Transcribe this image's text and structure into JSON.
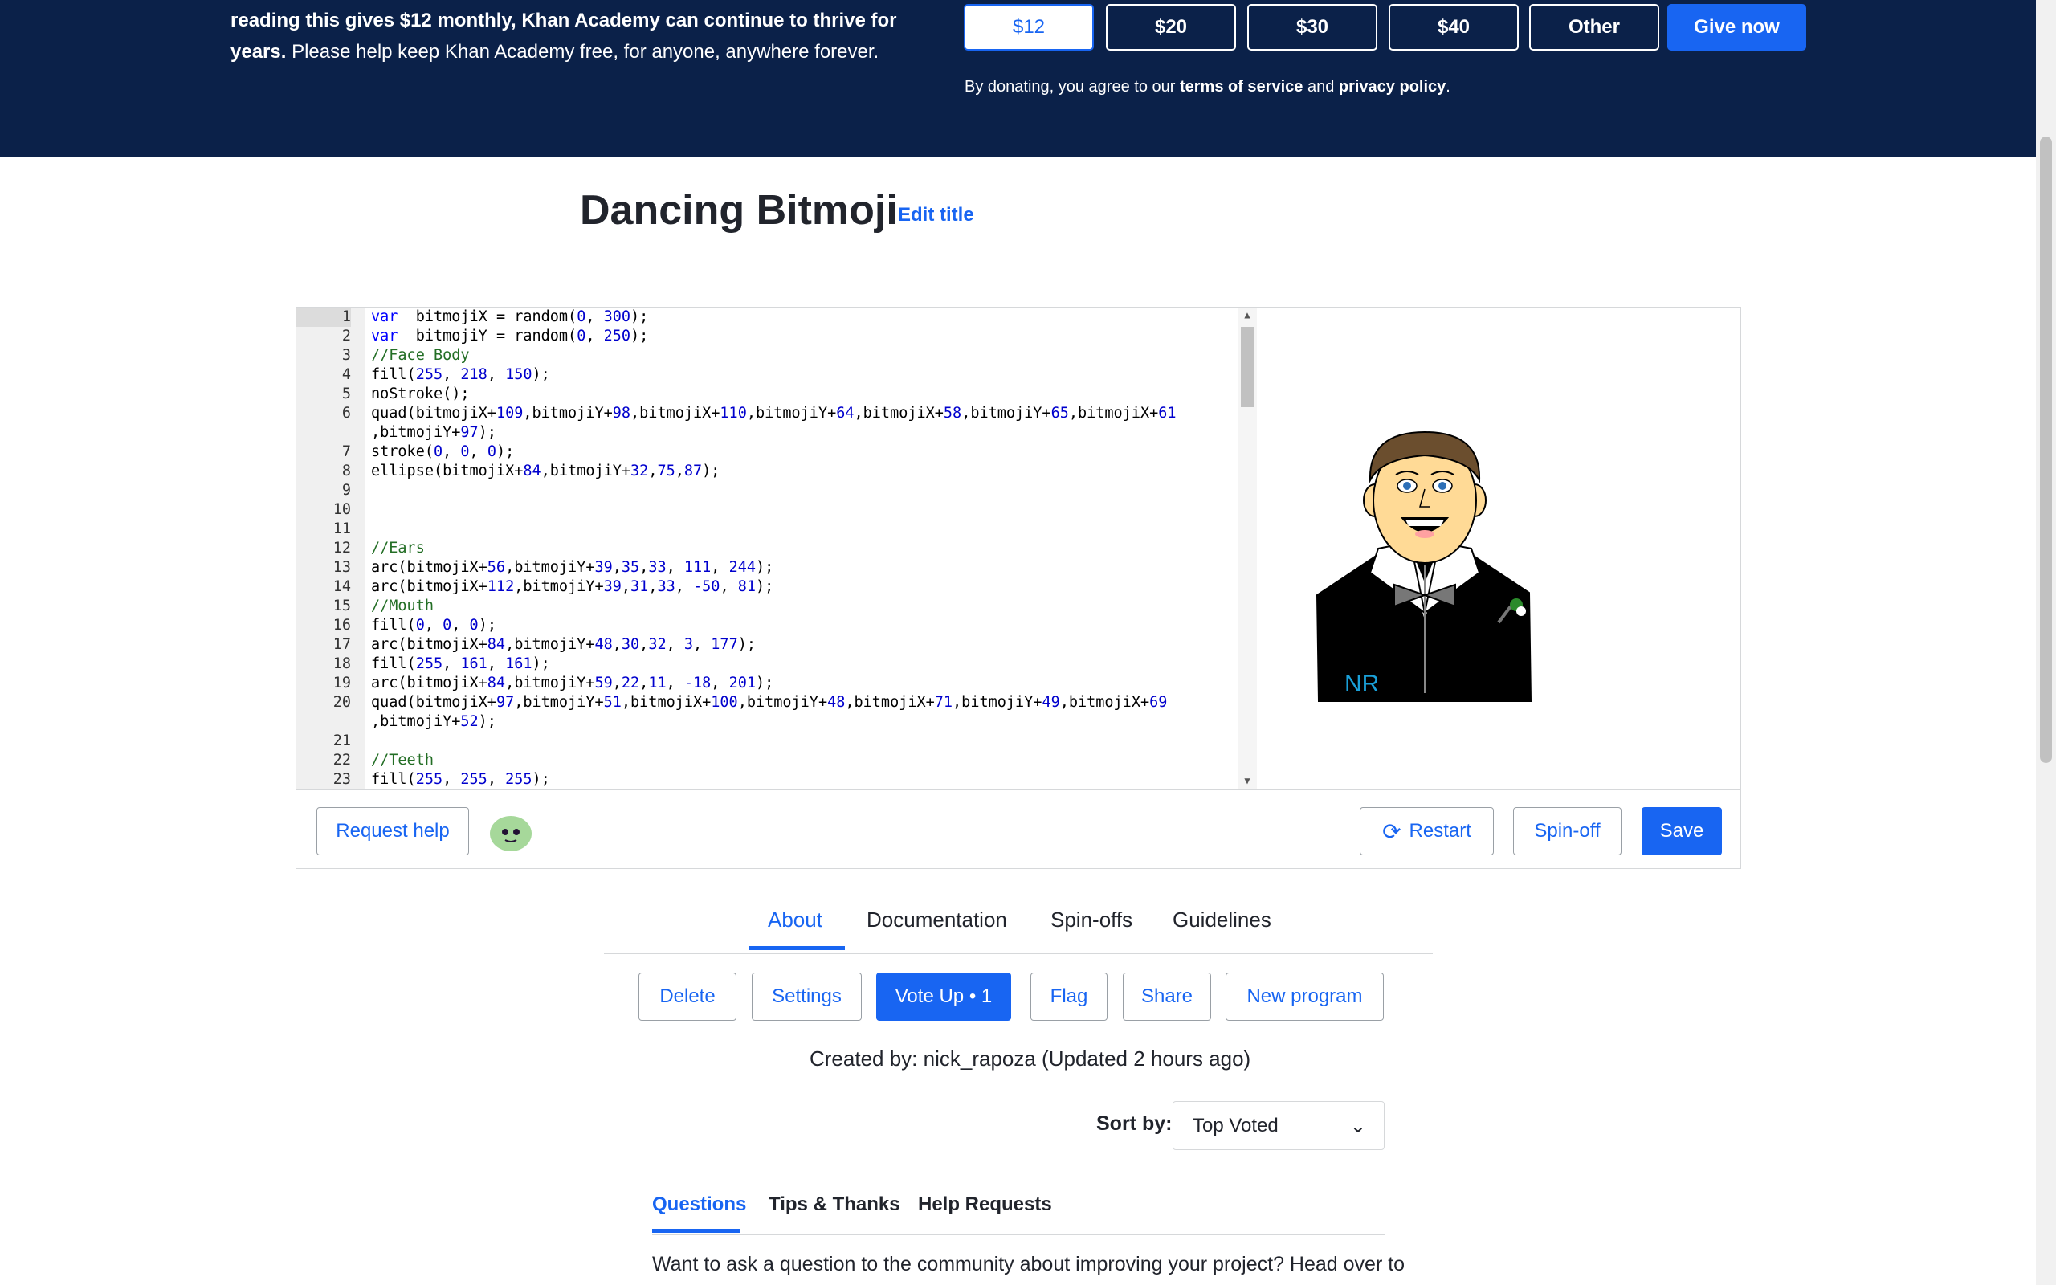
{
  "banner": {
    "text_bold_1": "reading this gives $12 monthly, Khan Academy can continue to thrive for",
    "text_bold_2": "years.",
    "text_rest": " Please help keep Khan Academy free, for anyone, anywhere forever.",
    "amounts": [
      "$12",
      "$20",
      "$30",
      "$40",
      "Other"
    ],
    "selected_amount": "$12",
    "give_now": "Give now",
    "terms_prefix": "By donating, you agree to our ",
    "terms_link": "terms of service",
    "terms_mid": " and ",
    "privacy_link": "privacy policy",
    "terms_suffix": "."
  },
  "program": {
    "title": "Dancing Bitmoji",
    "edit_title": "Edit title"
  },
  "editor": {
    "lines": [
      {
        "n": "1",
        "tokens": [
          [
            "kw",
            "var"
          ],
          [
            "",
            "  bitmojiX = random("
          ],
          [
            "num",
            "0"
          ],
          [
            "",
            ", "
          ],
          [
            "num",
            "300"
          ],
          [
            "",
            ");"
          ]
        ]
      },
      {
        "n": "2",
        "tokens": [
          [
            "kw",
            "var"
          ],
          [
            "",
            "  bitmojiY = random("
          ],
          [
            "num",
            "0"
          ],
          [
            "",
            ", "
          ],
          [
            "num",
            "250"
          ],
          [
            "",
            ");"
          ]
        ]
      },
      {
        "n": "3",
        "tokens": [
          [
            "cm",
            "//Face Body"
          ]
        ]
      },
      {
        "n": "4",
        "tokens": [
          [
            "",
            "fill("
          ],
          [
            "num",
            "255"
          ],
          [
            "",
            ", "
          ],
          [
            "num",
            "218"
          ],
          [
            "",
            ", "
          ],
          [
            "num",
            "150"
          ],
          [
            "",
            ");"
          ]
        ]
      },
      {
        "n": "5",
        "tokens": [
          [
            "",
            "noStroke();"
          ]
        ]
      },
      {
        "n": "6",
        "tokens": [
          [
            "",
            "quad(bitmojiX+"
          ],
          [
            "num",
            "109"
          ],
          [
            "",
            ",bitmojiY+"
          ],
          [
            "num",
            "98"
          ],
          [
            "",
            ",bitmojiX+"
          ],
          [
            "num",
            "110"
          ],
          [
            "",
            ",bitmojiY+"
          ],
          [
            "num",
            "64"
          ],
          [
            "",
            ",bitmojiX+"
          ],
          [
            "num",
            "58"
          ],
          [
            "",
            ",bitmojiY+"
          ],
          [
            "num",
            "65"
          ],
          [
            "",
            ",bitmojiX+"
          ],
          [
            "num",
            "61"
          ]
        ]
      },
      {
        "n": "",
        "tokens": [
          [
            "",
            ",bitmojiY+"
          ],
          [
            "num",
            "97"
          ],
          [
            "",
            ");"
          ]
        ]
      },
      {
        "n": "7",
        "tokens": [
          [
            "",
            "stroke("
          ],
          [
            "num",
            "0"
          ],
          [
            "",
            ", "
          ],
          [
            "num",
            "0"
          ],
          [
            "",
            ", "
          ],
          [
            "num",
            "0"
          ],
          [
            "",
            ");"
          ]
        ]
      },
      {
        "n": "8",
        "tokens": [
          [
            "",
            "ellipse(bitmojiX+"
          ],
          [
            "num",
            "84"
          ],
          [
            "",
            ",bitmojiY+"
          ],
          [
            "num",
            "32"
          ],
          [
            "",
            ","
          ],
          [
            "num",
            "75"
          ],
          [
            "",
            ","
          ],
          [
            "num",
            "87"
          ],
          [
            "",
            ");"
          ]
        ]
      },
      {
        "n": "9",
        "tokens": []
      },
      {
        "n": "10",
        "tokens": []
      },
      {
        "n": "11",
        "tokens": []
      },
      {
        "n": "12",
        "tokens": [
          [
            "cm",
            "//Ears"
          ]
        ]
      },
      {
        "n": "13",
        "tokens": [
          [
            "",
            "arc(bitmojiX+"
          ],
          [
            "num",
            "56"
          ],
          [
            "",
            ",bitmojiY+"
          ],
          [
            "num",
            "39"
          ],
          [
            "",
            ","
          ],
          [
            "num",
            "35"
          ],
          [
            "",
            ","
          ],
          [
            "num",
            "33"
          ],
          [
            "",
            ", "
          ],
          [
            "num",
            "111"
          ],
          [
            "",
            ", "
          ],
          [
            "num",
            "244"
          ],
          [
            "",
            ");"
          ]
        ]
      },
      {
        "n": "14",
        "tokens": [
          [
            "",
            "arc(bitmojiX+"
          ],
          [
            "num",
            "112"
          ],
          [
            "",
            ",bitmojiY+"
          ],
          [
            "num",
            "39"
          ],
          [
            "",
            ","
          ],
          [
            "num",
            "31"
          ],
          [
            "",
            ","
          ],
          [
            "num",
            "33"
          ],
          [
            "",
            ", "
          ],
          [
            "num",
            "-50"
          ],
          [
            "",
            ", "
          ],
          [
            "num",
            "81"
          ],
          [
            "",
            ");"
          ]
        ]
      },
      {
        "n": "15",
        "tokens": [
          [
            "cm",
            "//Mouth"
          ]
        ]
      },
      {
        "n": "16",
        "tokens": [
          [
            "",
            "fill("
          ],
          [
            "num",
            "0"
          ],
          [
            "",
            ", "
          ],
          [
            "num",
            "0"
          ],
          [
            "",
            ", "
          ],
          [
            "num",
            "0"
          ],
          [
            "",
            ");"
          ]
        ]
      },
      {
        "n": "17",
        "tokens": [
          [
            "",
            "arc(bitmojiX+"
          ],
          [
            "num",
            "84"
          ],
          [
            "",
            ",bitmojiY+"
          ],
          [
            "num",
            "48"
          ],
          [
            "",
            ","
          ],
          [
            "num",
            "30"
          ],
          [
            "",
            ","
          ],
          [
            "num",
            "32"
          ],
          [
            "",
            ", "
          ],
          [
            "num",
            "3"
          ],
          [
            "",
            ", "
          ],
          [
            "num",
            "177"
          ],
          [
            "",
            ");"
          ]
        ]
      },
      {
        "n": "18",
        "tokens": [
          [
            "",
            "fill("
          ],
          [
            "num",
            "255"
          ],
          [
            "",
            ", "
          ],
          [
            "num",
            "161"
          ],
          [
            "",
            ", "
          ],
          [
            "num",
            "161"
          ],
          [
            "",
            ");"
          ]
        ]
      },
      {
        "n": "19",
        "tokens": [
          [
            "",
            "arc(bitmojiX+"
          ],
          [
            "num",
            "84"
          ],
          [
            "",
            ",bitmojiY+"
          ],
          [
            "num",
            "59"
          ],
          [
            "",
            ","
          ],
          [
            "num",
            "22"
          ],
          [
            "",
            ","
          ],
          [
            "num",
            "11"
          ],
          [
            "",
            ", "
          ],
          [
            "num",
            "-18"
          ],
          [
            "",
            ", "
          ],
          [
            "num",
            "201"
          ],
          [
            "",
            ");"
          ]
        ]
      },
      {
        "n": "20",
        "tokens": [
          [
            "",
            "quad(bitmojiX+"
          ],
          [
            "num",
            "97"
          ],
          [
            "",
            ",bitmojiY+"
          ],
          [
            "num",
            "51"
          ],
          [
            "",
            ",bitmojiX+"
          ],
          [
            "num",
            "100"
          ],
          [
            "",
            ",bitmojiY+"
          ],
          [
            "num",
            "48"
          ],
          [
            "",
            ",bitmojiX+"
          ],
          [
            "num",
            "71"
          ],
          [
            "",
            ",bitmojiY+"
          ],
          [
            "num",
            "49"
          ],
          [
            "",
            ",bitmojiX+"
          ],
          [
            "num",
            "69"
          ]
        ]
      },
      {
        "n": "",
        "tokens": [
          [
            "",
            ",bitmojiY+"
          ],
          [
            "num",
            "52"
          ],
          [
            "",
            ");"
          ]
        ]
      },
      {
        "n": "21",
        "tokens": []
      },
      {
        "n": "22",
        "tokens": [
          [
            "cm",
            "//Teeth"
          ]
        ]
      },
      {
        "n": "23",
        "tokens": [
          [
            "",
            "fill("
          ],
          [
            "num",
            "255"
          ],
          [
            "",
            ", "
          ],
          [
            "num",
            "255"
          ],
          [
            "",
            ", "
          ],
          [
            "num",
            "255"
          ],
          [
            "",
            ");"
          ]
        ]
      }
    ],
    "canvas_badge": "NR",
    "request_help": "Request help",
    "restart": "Restart",
    "spin_off": "Spin-off",
    "save": "Save"
  },
  "tabs": [
    "About",
    "Documentation",
    "Spin-offs",
    "Guidelines"
  ],
  "active_tab": "About",
  "actions": {
    "delete": "Delete",
    "settings": "Settings",
    "vote_up": "Vote Up • 1",
    "flag": "Flag",
    "share": "Share",
    "new_program": "New program"
  },
  "created": "Created by: nick_rapoza (Updated 2 hours ago)",
  "sort": {
    "label": "Sort by:",
    "value": "Top Voted"
  },
  "subtabs": [
    "Questions",
    "Tips & Thanks",
    "Help Requests"
  ],
  "active_subtab": "Questions",
  "help_text": "Want to ask a question to the community about improving your project? Head over to",
  "colors": {
    "banner_bg": "#0b2149",
    "accent": "#1865f2"
  }
}
